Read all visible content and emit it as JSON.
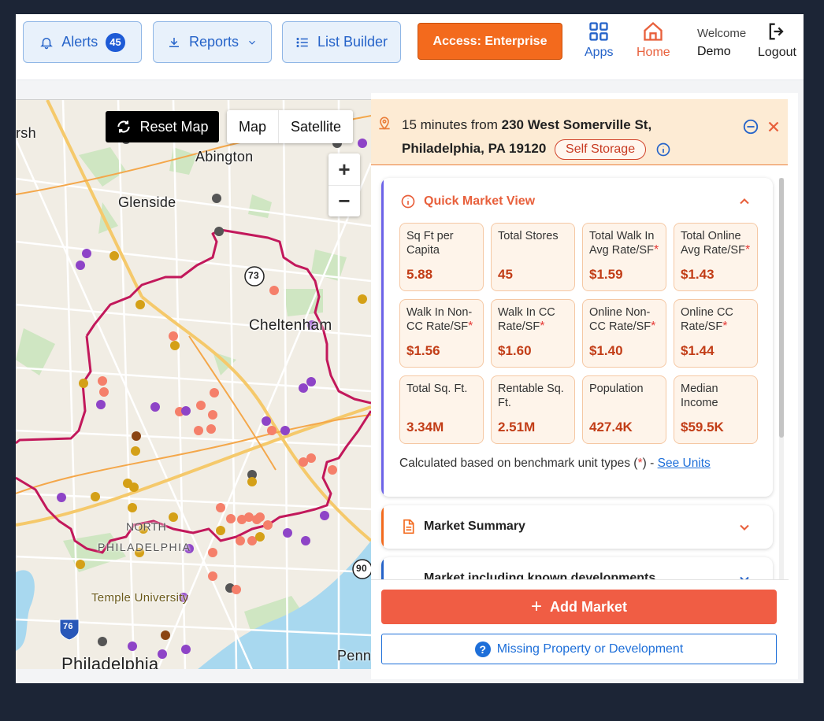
{
  "nav": {
    "alerts_label": "Alerts",
    "alerts_count": "45",
    "reports_label": "Reports",
    "list_builder_label": "List Builder",
    "access_label": "Access: Enterprise",
    "apps_label": "Apps",
    "home_label": "Home",
    "welcome_label": "Welcome",
    "user_name": "Demo",
    "logout_label": "Logout"
  },
  "map": {
    "reset_label": "Reset Map",
    "type_options": [
      "Map",
      "Satellite"
    ],
    "zoom_in": "+",
    "zoom_out": "−",
    "labels": {
      "rsh": "rsh",
      "abington": "Abington",
      "glenside": "Glenside",
      "cheltenham": "Cheltenham",
      "north": "NORTH",
      "philadelphia_area": "PHILADELPHIA",
      "temple": "Temple University",
      "philadelphia": "Philadelphia",
      "penn": "Penn",
      "route73": "73",
      "route76": "76",
      "route90": "90"
    }
  },
  "address": {
    "prefix": "15 minutes from ",
    "street": "230 West Somerville St,",
    "city": "Philadelphia, PA 19120",
    "type_pill": "Self Storage"
  },
  "quick_view": {
    "title": "Quick Market View",
    "tiles": [
      {
        "label": "Sq Ft per Capita",
        "value": "5.88",
        "star": ""
      },
      {
        "label": "Total Stores",
        "value": "45",
        "star": ""
      },
      {
        "label": "Total Walk In Avg Rate/SF",
        "value": "$1.59",
        "star": "*"
      },
      {
        "label": "Total Online Avg Rate/SF",
        "value": "$1.43",
        "star": "*"
      },
      {
        "label": "Walk In Non-CC Rate/SF",
        "value": "$1.56",
        "star": "*"
      },
      {
        "label": "Walk In CC Rate/SF",
        "value": "$1.60",
        "star": "*"
      },
      {
        "label": "Online Non-CC Rate/SF",
        "value": "$1.40",
        "star": "*"
      },
      {
        "label": "Online CC Rate/SF",
        "value": "$1.44",
        "star": "*"
      },
      {
        "label": "Total Sq. Ft.",
        "value": "3.34M",
        "star": ""
      },
      {
        "label": "Rentable Sq. Ft.",
        "value": "2.51M",
        "star": ""
      },
      {
        "label": "Population",
        "value": "427.4K",
        "star": ""
      },
      {
        "label": "Median Income",
        "value": "$59.5K",
        "star": ""
      }
    ],
    "note_prefix": "Calculated based on benchmark unit types (",
    "note_star": "*",
    "note_suffix": ") - ",
    "note_link": "See Units"
  },
  "sections": {
    "market_summary": "Market Summary",
    "market_known": "Market including known developments"
  },
  "actions": {
    "add_market": "Add Market",
    "missing": "Missing Property or Development"
  },
  "colors": {
    "accent_orange": "#f36a1d",
    "accent_blue": "#2563c9",
    "boundary": "#c2185b",
    "add_button": "#f05d44"
  }
}
